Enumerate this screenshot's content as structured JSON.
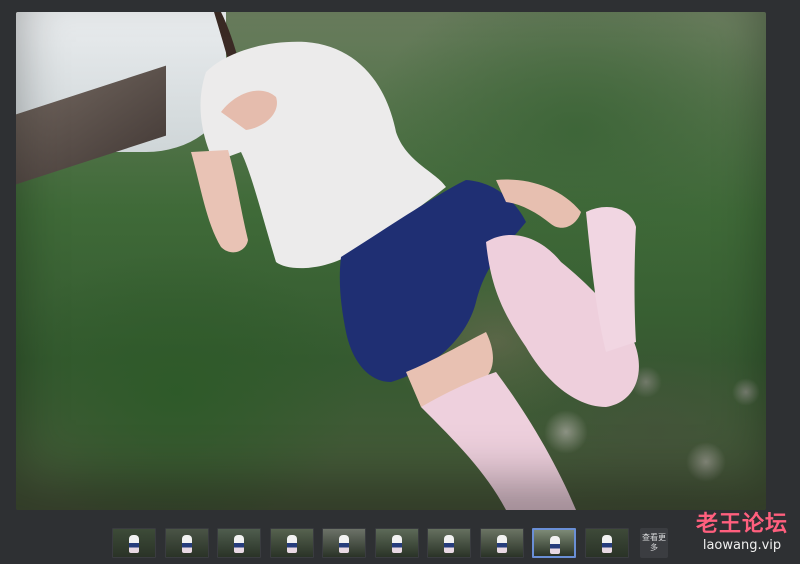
{
  "viewer": {
    "more_button_label": "查看更多",
    "thumbnails": [
      {
        "icon": "photo-thumbnail",
        "active": false,
        "tone": "#3d4b38"
      },
      {
        "icon": "photo-thumbnail",
        "active": false,
        "tone": "#4a5446"
      },
      {
        "icon": "photo-thumbnail",
        "active": false,
        "tone": "#4f5d4e"
      },
      {
        "icon": "photo-thumbnail",
        "active": false,
        "tone": "#56624f"
      },
      {
        "icon": "photo-thumbnail",
        "active": false,
        "tone": "#6c7268"
      },
      {
        "icon": "photo-thumbnail",
        "active": false,
        "tone": "#5d6a58"
      },
      {
        "icon": "photo-thumbnail",
        "active": false,
        "tone": "#65705f"
      },
      {
        "icon": "photo-thumbnail",
        "active": false,
        "tone": "#6b7464"
      },
      {
        "icon": "photo-thumbnail",
        "active": true,
        "tone": "#7d8a76"
      },
      {
        "icon": "photo-thumbnail",
        "active": false,
        "tone": "#3e4a39"
      }
    ]
  },
  "watermark": {
    "title": "老王论坛",
    "url": "laowang.vip",
    "title_color": "#ff5f7e"
  },
  "colors": {
    "active_border": "#6a8fd6",
    "background": "#2e3033"
  }
}
